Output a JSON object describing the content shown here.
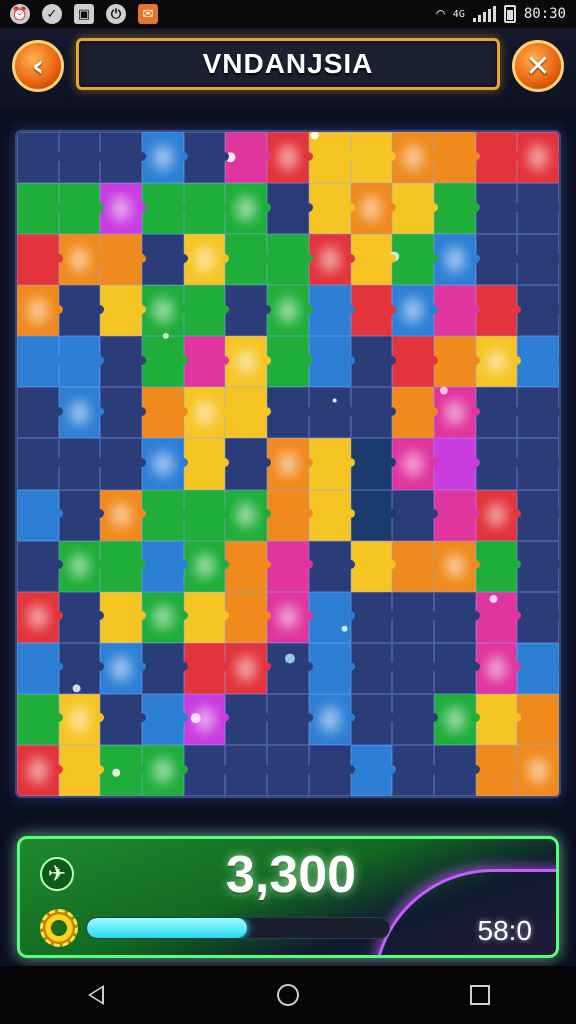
{
  "status_bar": {
    "time": "80:30",
    "icons": [
      "alarm-icon",
      "check-icon",
      "image-icon",
      "power-icon",
      "app-icon"
    ],
    "network_label": "4G"
  },
  "header": {
    "title": "VNDANJSIA",
    "back_icon": "chevron-left-icon",
    "close_icon": "close-x-icon"
  },
  "board": {
    "columns": 13,
    "rows": 13,
    "palette": {
      "G": "#1fae3a",
      "O": "#f08a1c",
      "Y": "#f6c524",
      "P": "#e0359e",
      "M": "#c83ce0",
      "R": "#e3333b",
      "B": "#2a3d78",
      "C": "#2d7fd6",
      "T": "#1b3a6e"
    },
    "layout": [
      "BBBCBPRYYOORR",
      "GGMGGGBYOYGBB",
      "ROOBYGGRYGCBB",
      "OBYGGBGCRCPRB",
      "CCBGPYGCBROYC",
      "BCBOYYBBBOPBB",
      "BBBCYBOYTPMBB",
      "CBOGGGOYTBPRB",
      "BGGCGOPBYOOGB",
      "RBYGYOPCBBBPB",
      "CBCBRRBCBBBPC",
      "GYBCMBBCBBGYO",
      "RYGGBBBBCBBOO"
    ]
  },
  "panel": {
    "score": "3,300",
    "progress": 0.53,
    "timer": "58:0",
    "score_icon": "plane-icon",
    "gear_icon": "gear-icon"
  }
}
